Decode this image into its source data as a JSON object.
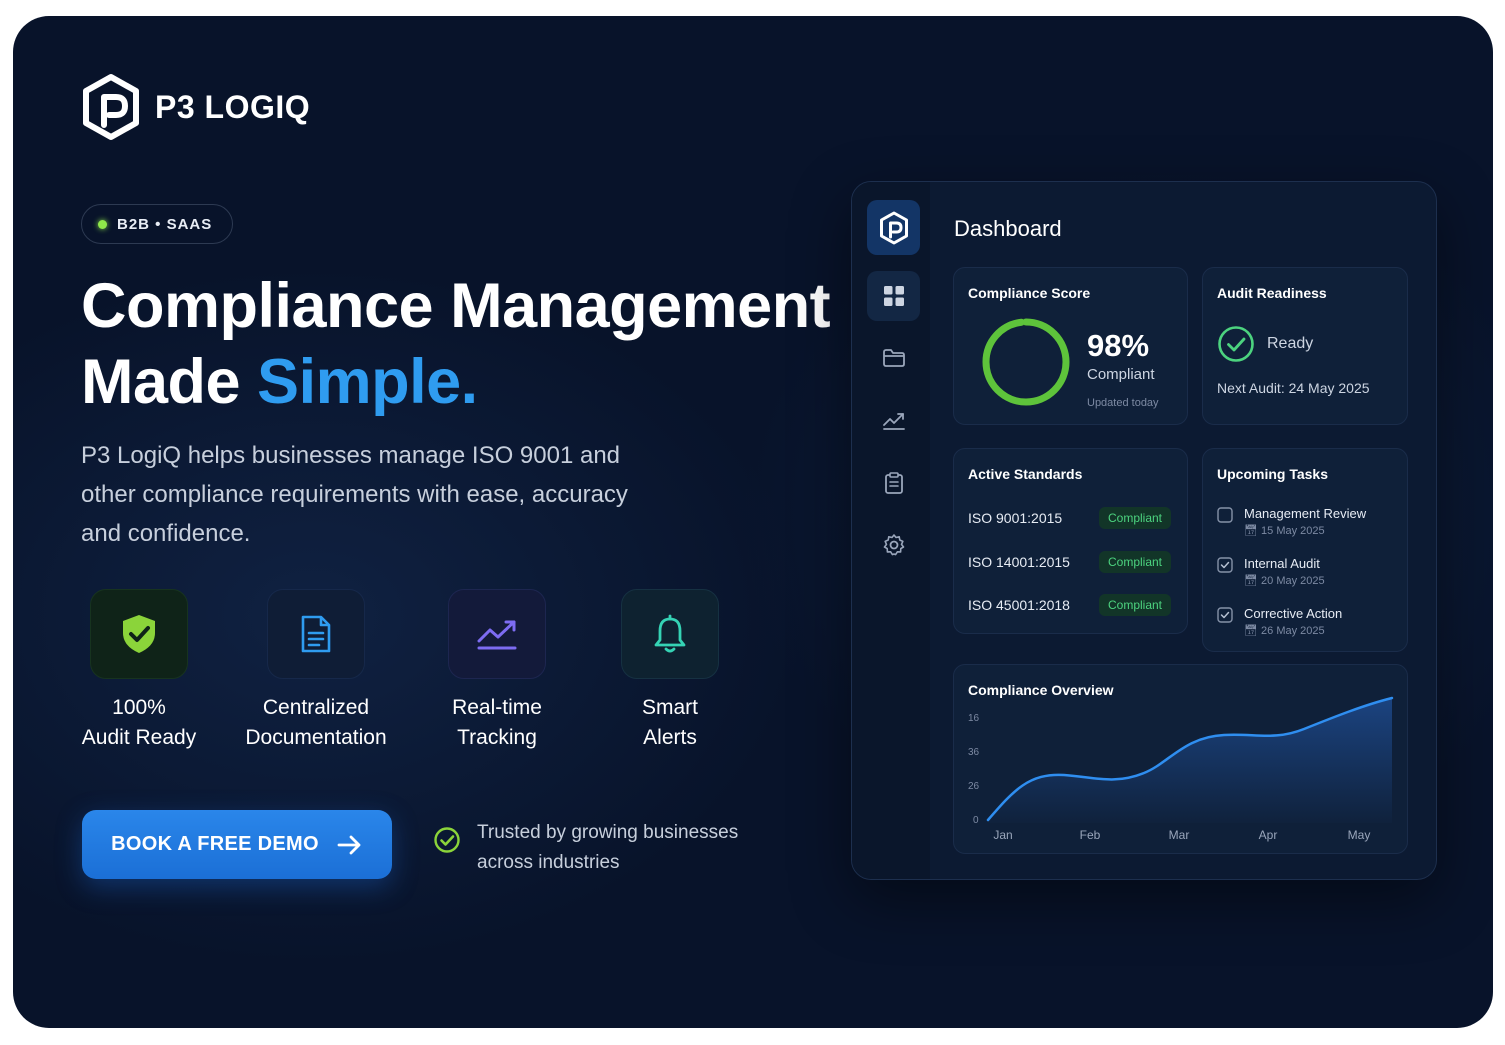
{
  "brand": {
    "name": "P3 LOGIQ"
  },
  "badge": {
    "text": "B2B • SAAS"
  },
  "hero": {
    "headline_line1": "Compliance Management",
    "headline_line2_plain": "Made ",
    "headline_line2_accent": "Simple.",
    "subtext": "P3 LogiQ helps businesses manage ISO 9001 and other compliance requirements with ease, accuracy and confidence."
  },
  "features": [
    {
      "icon": "shield-check-icon",
      "line1": "100%",
      "line2": "Audit Ready"
    },
    {
      "icon": "document-icon",
      "line1": "Centralized",
      "line2": "Documentation"
    },
    {
      "icon": "trend-chart-icon",
      "line1": "Real-time",
      "line2": "Tracking"
    },
    {
      "icon": "bell-icon",
      "line1": "Smart",
      "line2": "Alerts"
    }
  ],
  "cta": {
    "label": "BOOK A FREE DEMO"
  },
  "trust": {
    "text": "Trusted by growing businesses across industries"
  },
  "dashboard": {
    "title": "Dashboard",
    "sidebar": [
      "grid-icon",
      "folder-icon",
      "trend-icon",
      "clipboard-icon",
      "gear-icon"
    ],
    "compliance_score": {
      "title": "Compliance Score",
      "value": "98%",
      "percent": 98,
      "status": "Compliant",
      "updated": "Updated today"
    },
    "audit_readiness": {
      "title": "Audit Readiness",
      "status": "Ready",
      "next_audit": "Next Audit: 24 May 2025"
    },
    "active_standards": {
      "title": "Active Standards",
      "items": [
        {
          "name": "ISO 9001:2015",
          "status": "Compliant"
        },
        {
          "name": "ISO 14001:2015",
          "status": "Compliant"
        },
        {
          "name": "ISO 45001:2018",
          "status": "Compliant"
        }
      ]
    },
    "upcoming_tasks": {
      "title": "Upcoming Tasks",
      "items": [
        {
          "name": "Management Review",
          "date": "15 May 2025"
        },
        {
          "name": "Internal Audit",
          "date": "20 May 2025"
        },
        {
          "name": "Corrective Action",
          "date": "26 May 2025"
        }
      ]
    },
    "overview": {
      "title": "Compliance Overview",
      "y_ticks": [
        "16",
        "36",
        "26",
        "0"
      ],
      "x_ticks": [
        "Jan",
        "Feb",
        "Mar",
        "Apr",
        "May"
      ]
    }
  },
  "colors": {
    "background": "#08132a",
    "accent": "#2f9cf0",
    "cta": "#1f78e0",
    "success": "#4cd37f"
  }
}
